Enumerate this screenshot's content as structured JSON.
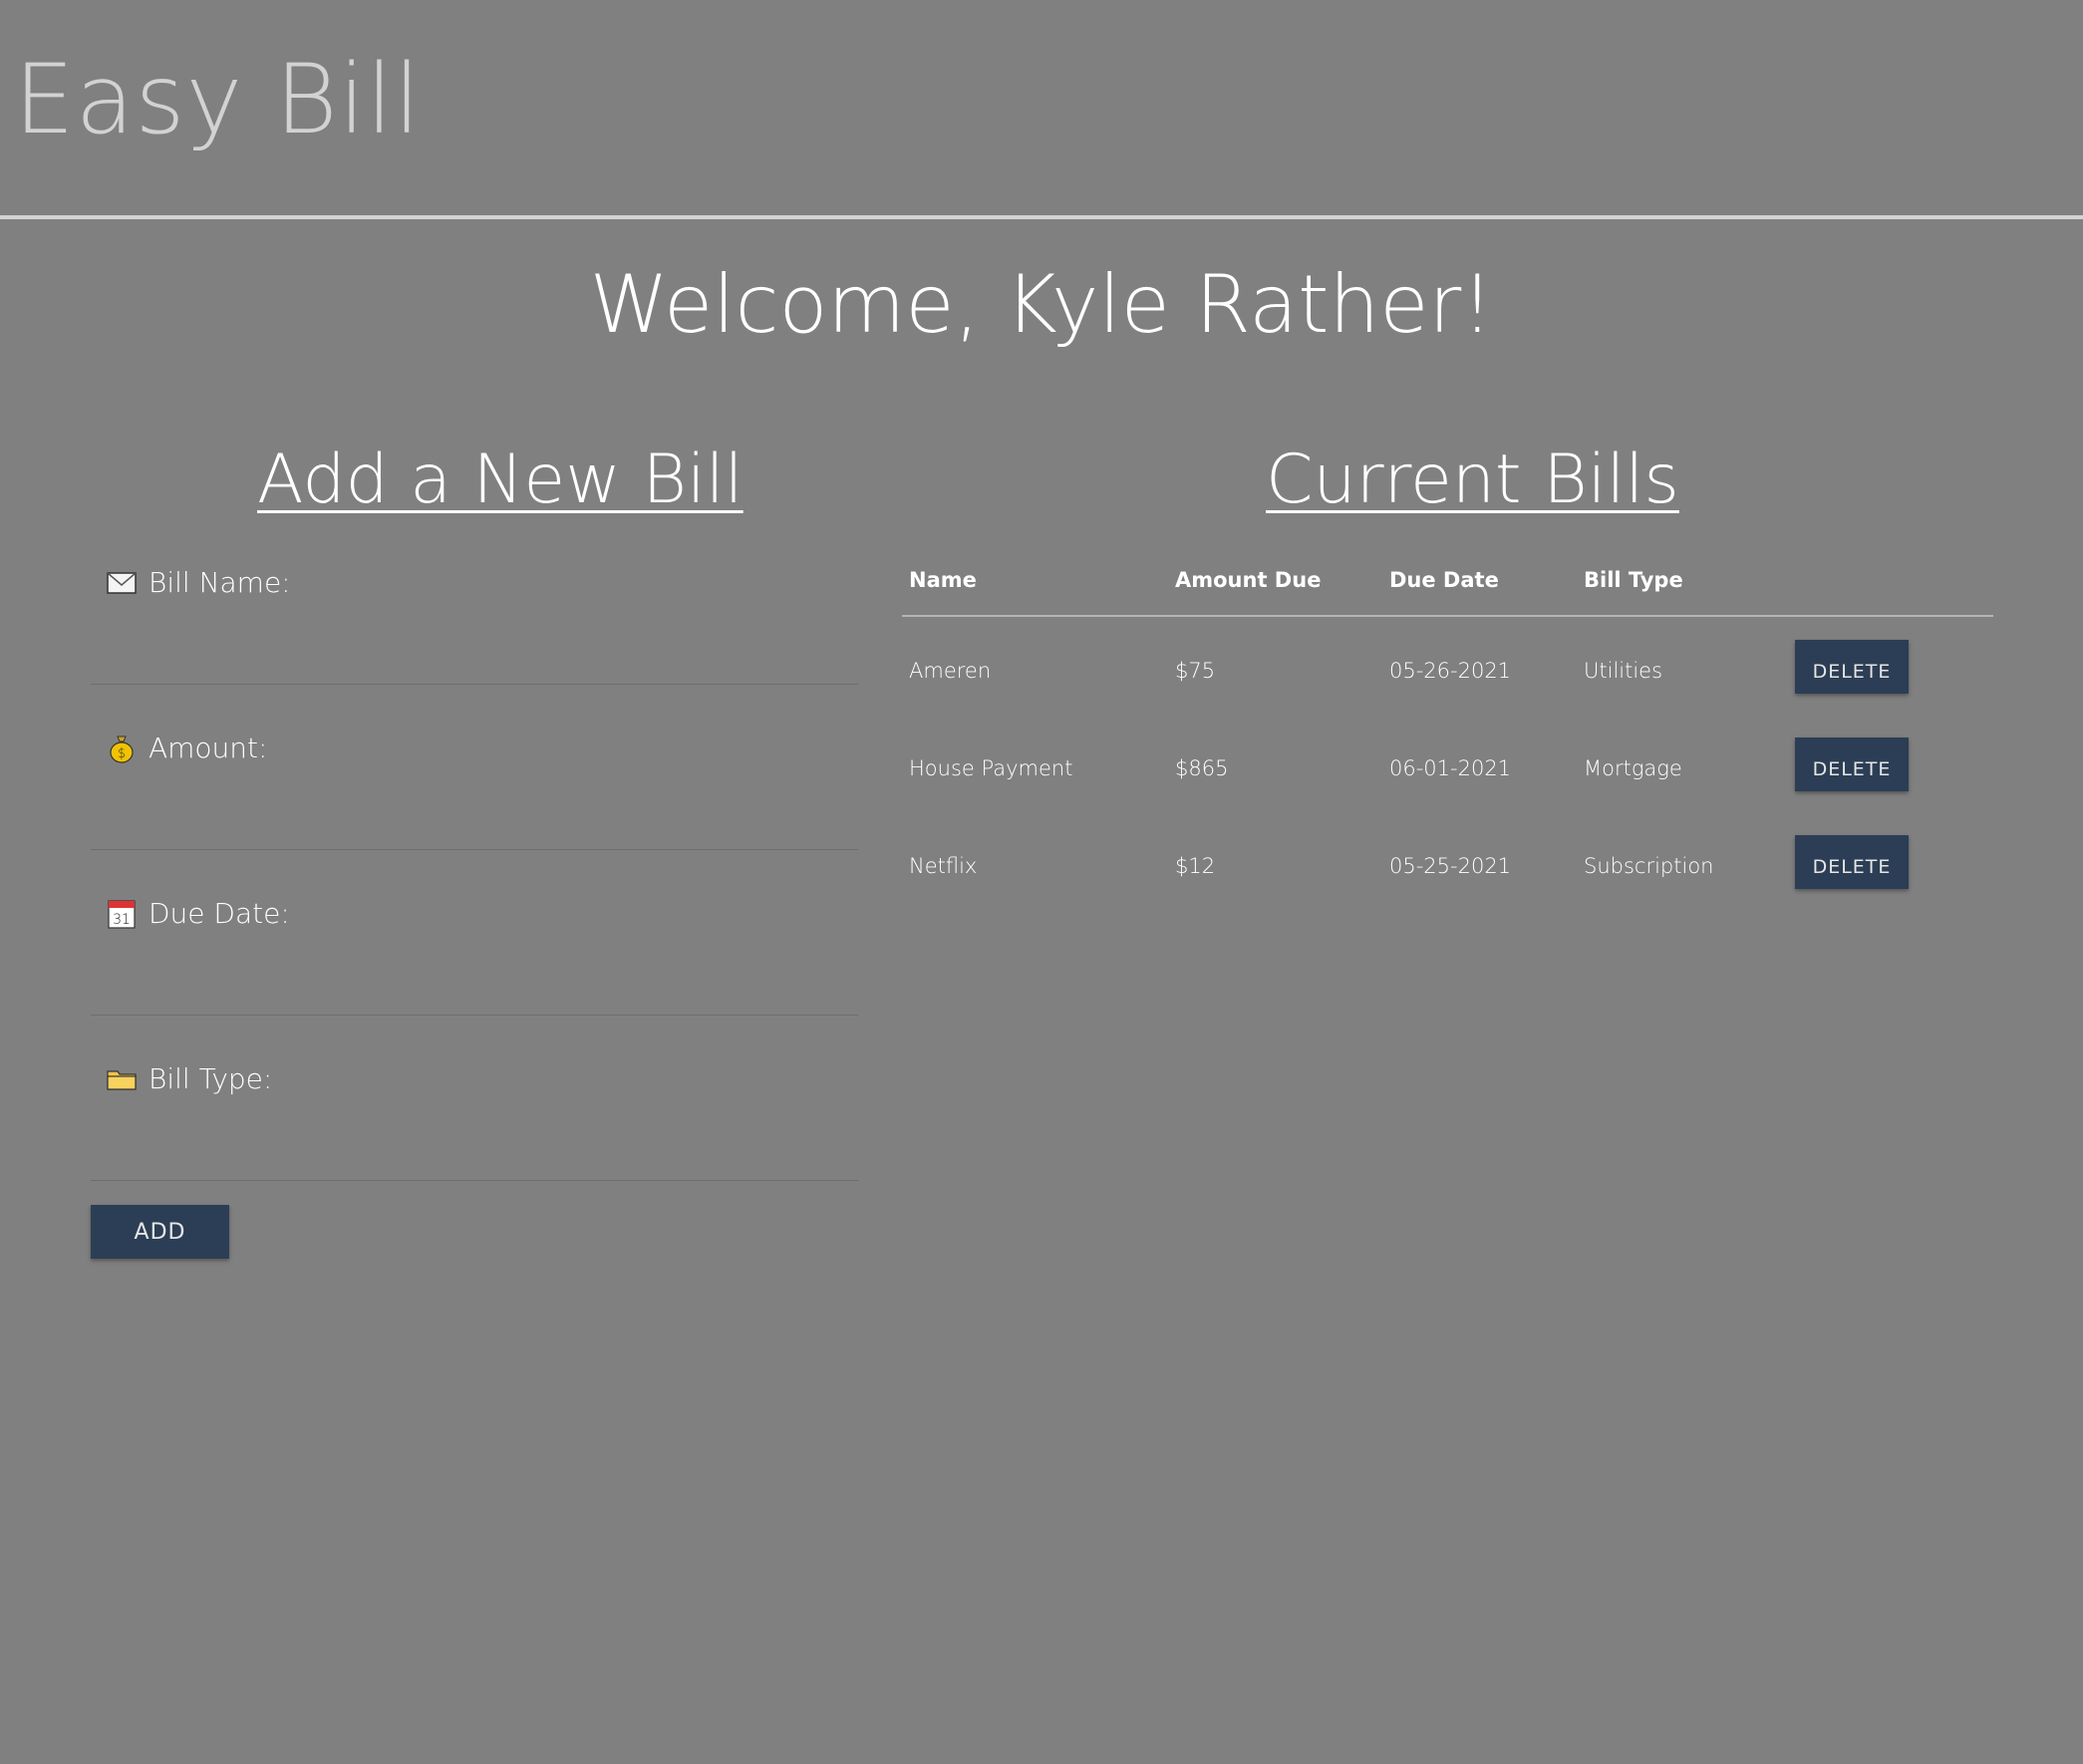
{
  "app": {
    "title": "Easy Bill"
  },
  "welcome": "Welcome, Kyle Rather!",
  "form": {
    "title": "Add a New Bill",
    "fields": [
      {
        "label": "Bill Name:",
        "icon": "envelope-icon",
        "value": ""
      },
      {
        "label": "Amount:",
        "icon": "money-bag-icon",
        "value": ""
      },
      {
        "label": "Due Date:",
        "icon": "calendar-icon",
        "value": ""
      },
      {
        "label": "Bill Type:",
        "icon": "folder-icon",
        "value": ""
      }
    ],
    "add_label": "ADD"
  },
  "bills": {
    "title": "Current Bills",
    "headers": [
      "Name",
      "Amount Due",
      "Due Date",
      "Bill Type"
    ],
    "rows": [
      {
        "name": "Ameren",
        "amount": "$75",
        "due": "05-26-2021",
        "type": "Utilities"
      },
      {
        "name": "House Payment",
        "amount": "$865",
        "due": "06-01-2021",
        "type": "Mortgage"
      },
      {
        "name": "Netflix",
        "amount": "$12",
        "due": "05-25-2021",
        "type": "Subscription"
      }
    ],
    "delete_label": "DELETE"
  },
  "colors": {
    "background": "#808080",
    "button": "#2c3e55",
    "header_rule": "#d4d4d4"
  }
}
